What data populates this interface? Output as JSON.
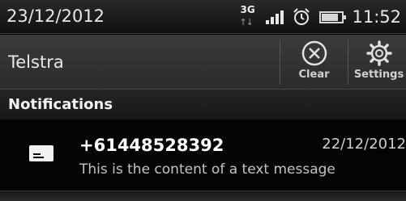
{
  "status_bar": {
    "date": "23/12/2012",
    "network_type": "3G",
    "signal_icon": "signal-bars-icon",
    "alarm_icon": "alarm-clock-icon",
    "battery_icon": "battery-icon",
    "battery_level": 0.85,
    "time": "11:52"
  },
  "action_bar": {
    "carrier": "Telstra",
    "clear": {
      "label": "Clear",
      "icon": "close-circle-icon"
    },
    "settings": {
      "label": "Settings",
      "icon": "gear-icon"
    }
  },
  "section": {
    "title": "Notifications"
  },
  "notification": {
    "icon": "message-icon",
    "sender": "+61448528392",
    "date": "22/12/2012",
    "body": "This is the content of a text message"
  }
}
